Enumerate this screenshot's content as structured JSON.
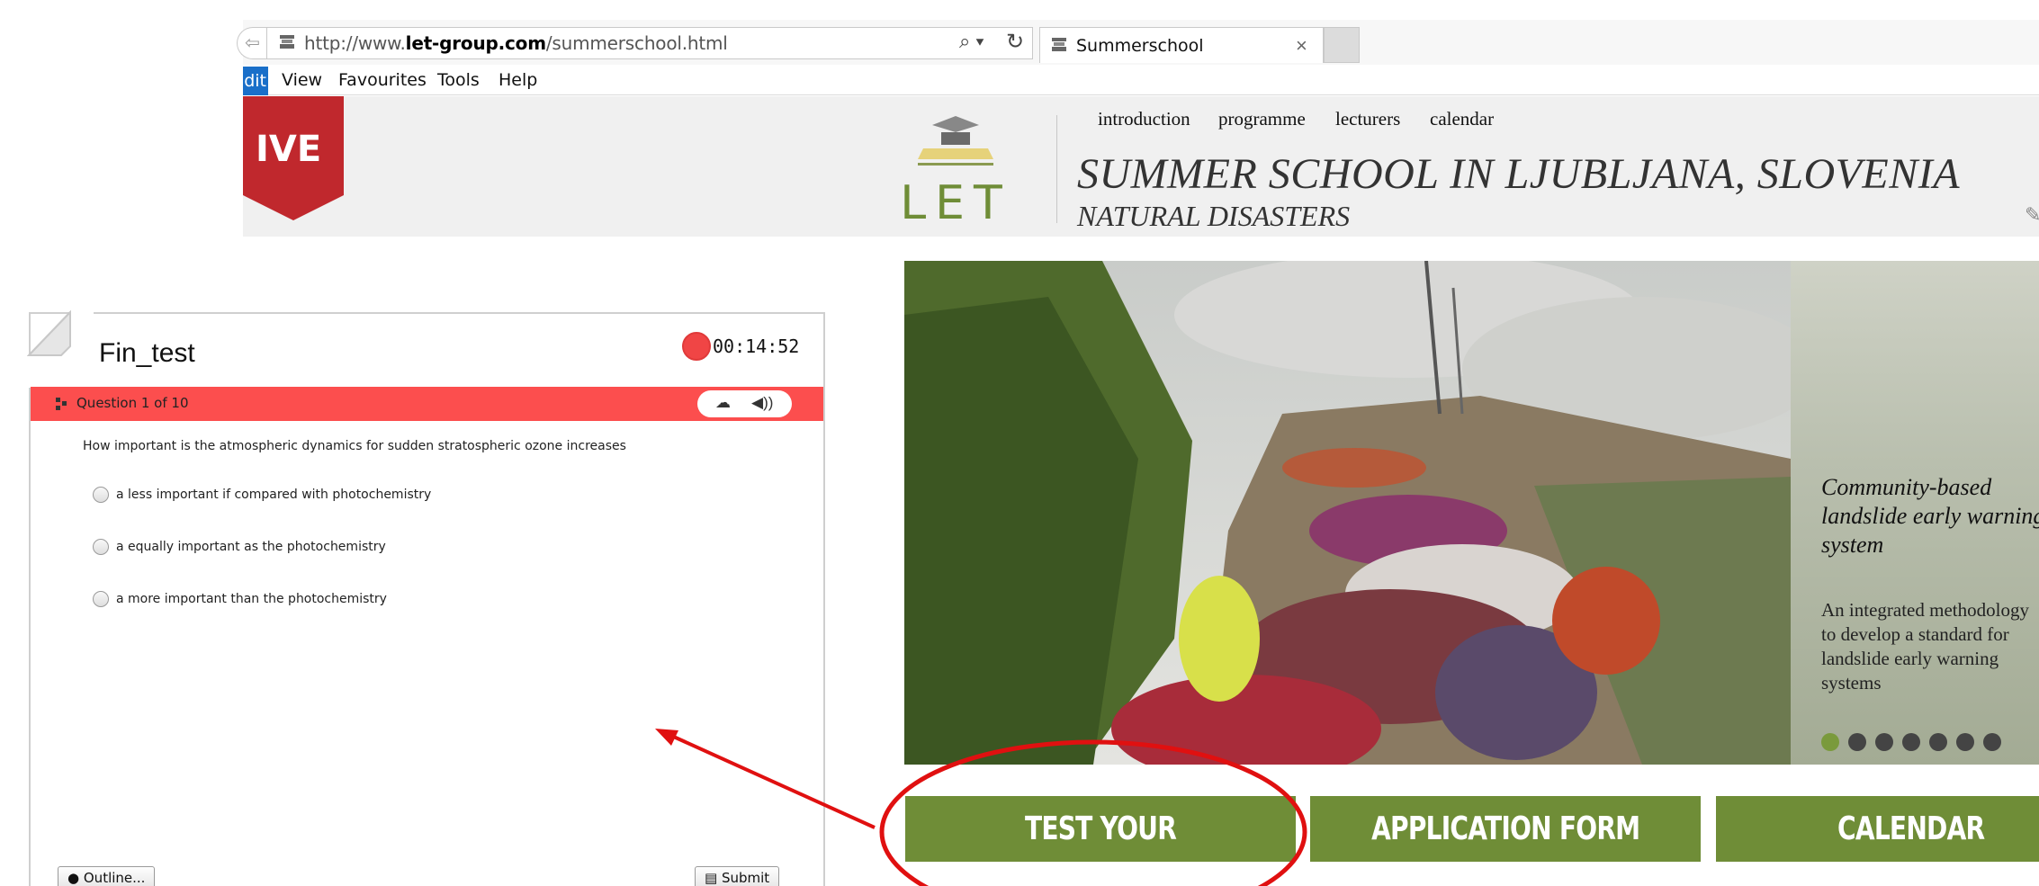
{
  "browser": {
    "url_prefix": "http://www.",
    "url_domain": "let-group.com",
    "url_path": "/summerschool.html",
    "tab_title": "Summerschool",
    "tab_close": "×",
    "menu": [
      "dit",
      "View",
      "Favourites",
      "Tools",
      "Help"
    ]
  },
  "header": {
    "badge_text": "IVE",
    "logo_text": "LET",
    "nav": [
      "introduction",
      "programme",
      "lecturers",
      "calendar"
    ],
    "title": "SUMMER SCHOOL IN LJUBLJANA, SLOVENIA",
    "subtitle": "NATURAL DISASTERS"
  },
  "slider": {
    "title": "Community-based landslide early warning system",
    "description": "An integrated methodology to develop a standard for landslide early warning systems",
    "dot_count": 7,
    "active_dot": 0
  },
  "buttons": [
    "TEST YOUR KNOWLEDGE",
    "APPLICATION FORM",
    "CALENDAR"
  ],
  "quiz": {
    "title": "Fin_test",
    "timer": "00:14:52",
    "question_counter": "Question 1 of 10",
    "question": "How important is the atmospheric dynamics for sudden stratospheric ozone increases",
    "options": [
      "a less important if compared with photochemistry",
      "a equally important as the photochemistry",
      "a more important than the photochemistry"
    ],
    "outline_label": "Outline...",
    "submit_label": "Submit"
  },
  "colors": {
    "accent_green": "#6f8d37",
    "quiz_bar_red": "#fc4e4e",
    "annotation_red": "#e01010",
    "live_badge_red": "#c0282d"
  }
}
